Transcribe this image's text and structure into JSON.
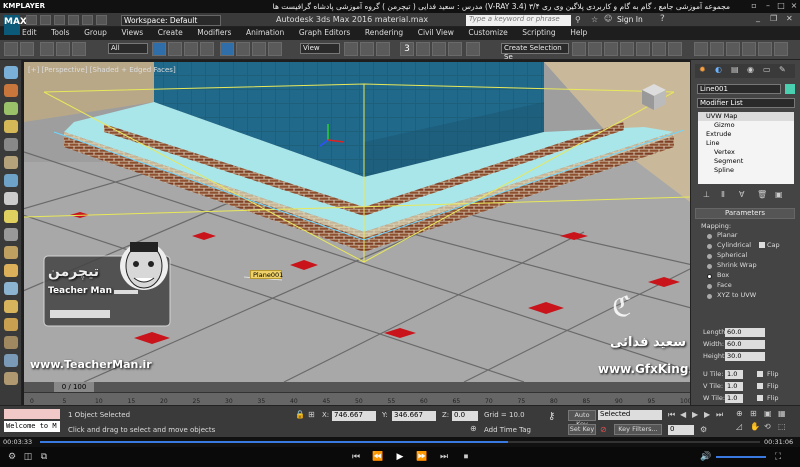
{
  "player": {
    "logo": "KMPLAYER",
    "title": "مجموعه آموزشی جامع ، گام به گام و کاربردی پلاگین وی ری ۳/۴ (V-RAY 3.4) مدرس : سعید فدایی ( تیچرمن ) گروه آموزشی پادشاه گرافیست ها",
    "time_elapsed": "00:02:29",
    "time_total": "00:31:06",
    "time_start": "00:03:33"
  },
  "app": {
    "logo": "MAX",
    "workspace": "Workspace: Default",
    "title": "Autodesk 3ds Max 2016   material.max",
    "search_placeholder": "Type a keyword or phrase",
    "signin": "Sign In"
  },
  "menu": [
    "Edit",
    "Tools",
    "Group",
    "Views",
    "Create",
    "Modifiers",
    "Animation",
    "Graph Editors",
    "Rendering",
    "Civil View",
    "Customize",
    "Scripting",
    "Help"
  ],
  "toolbar": {
    "filter": "All",
    "ref_coord": "View",
    "selection_set": "Create Selection Se",
    "snap_number": "3"
  },
  "viewport": {
    "label": "[+] [Perspective] [Shaded + Edged Faces]",
    "object_label": "Plane001"
  },
  "command_panel": {
    "object_name": "Line001",
    "modifier_list": "Modifier List",
    "stack": [
      "UVW Map",
      "Gizmo",
      "Extrude",
      "Line",
      "Vertex",
      "Segment",
      "Spline"
    ],
    "params_title": "Parameters",
    "mapping_label": "Mapping:",
    "mapping_options": [
      "Planar",
      "Cylindrical",
      "Spherical",
      "Shrink Wrap",
      "Box",
      "Face",
      "XYZ to UVW"
    ],
    "cap_label": "Cap",
    "selected_mapping": "Box",
    "length_label": "Length:",
    "length": "60.0",
    "width_label": "Width:",
    "width": "60.0",
    "height_label": "Height:",
    "height": "30.0",
    "utile_label": "U Tile:",
    "utile": "1.0",
    "vtile_label": "V Tile:",
    "vtile": "1.0",
    "wtile_label": "W Tile:",
    "wtile": "1.0",
    "flip_label": "Flip"
  },
  "timeline": {
    "frame": "0 / 100",
    "ticks": [
      "0",
      "5",
      "10",
      "15",
      "20",
      "25",
      "30",
      "35",
      "40",
      "45",
      "50",
      "55",
      "60",
      "65",
      "70",
      "75",
      "80",
      "85",
      "90",
      "95",
      "100"
    ]
  },
  "status": {
    "maxscript": "Welcome to M",
    "selected": "1 Object Selected",
    "prompt": "Click and drag to select and move objects",
    "x_label": "X:",
    "x": "746.667",
    "y_label": "Y:",
    "y": "346.667",
    "z_label": "Z:",
    "z": "0.0",
    "grid": "Grid = 10.0",
    "auto_key": "Auto Key",
    "key_mode": "Selected",
    "set_key": "Set Key",
    "key_filters": "Key Filters...",
    "add_time_tag": "Add Time Tag",
    "frame_field": "0"
  },
  "watermarks": {
    "teacherman": "www.TeacherMan.ir",
    "teacherman_brand": "Teacher Man",
    "teacherman_persian": "تیچرمن",
    "gfxking": "www.GfxKing.ir",
    "persian_name": "سعید فدائی"
  },
  "colors": {
    "tile_blue": "#1e5f7a",
    "brick": "#8a4a2c",
    "water": "#a9e6ea",
    "floor": "#9a9a9a",
    "red_diamond": "#c8141a",
    "selection_yellow": "#e8e85a"
  }
}
